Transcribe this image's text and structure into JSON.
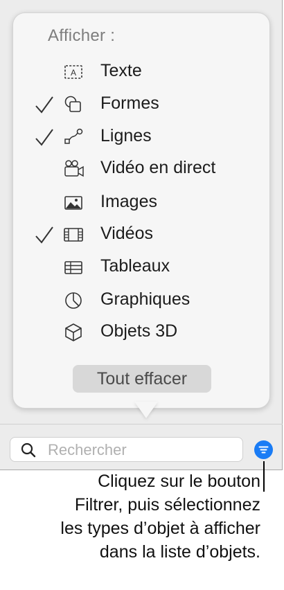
{
  "popover": {
    "heading": "Afficher :",
    "items": [
      {
        "label": "Texte",
        "checked": false,
        "icon": "text-box-icon"
      },
      {
        "label": "Formes",
        "checked": true,
        "icon": "shapes-icon"
      },
      {
        "label": "Lignes",
        "checked": true,
        "icon": "lines-icon"
      },
      {
        "label": "Vidéo en direct",
        "checked": false,
        "icon": "live-video-icon"
      },
      {
        "label": "Images",
        "checked": false,
        "icon": "image-icon"
      },
      {
        "label": "Vidéos",
        "checked": true,
        "icon": "film-icon"
      },
      {
        "label": "Tableaux",
        "checked": false,
        "icon": "table-icon"
      },
      {
        "label": "Graphiques",
        "checked": false,
        "icon": "chart-icon"
      },
      {
        "label": "Objets 3D",
        "checked": false,
        "icon": "cube-icon"
      }
    ],
    "clear_label": "Tout effacer"
  },
  "search": {
    "placeholder": "Rechercher",
    "value": ""
  },
  "filter_button": {
    "icon": "filter-icon",
    "color": "#1a7cf5"
  },
  "callout": {
    "lines": [
      "Cliquez sur le bouton",
      "Filtrer, puis sélectionnez",
      "les types d’objet à afficher",
      "dans la liste d’objets."
    ]
  }
}
